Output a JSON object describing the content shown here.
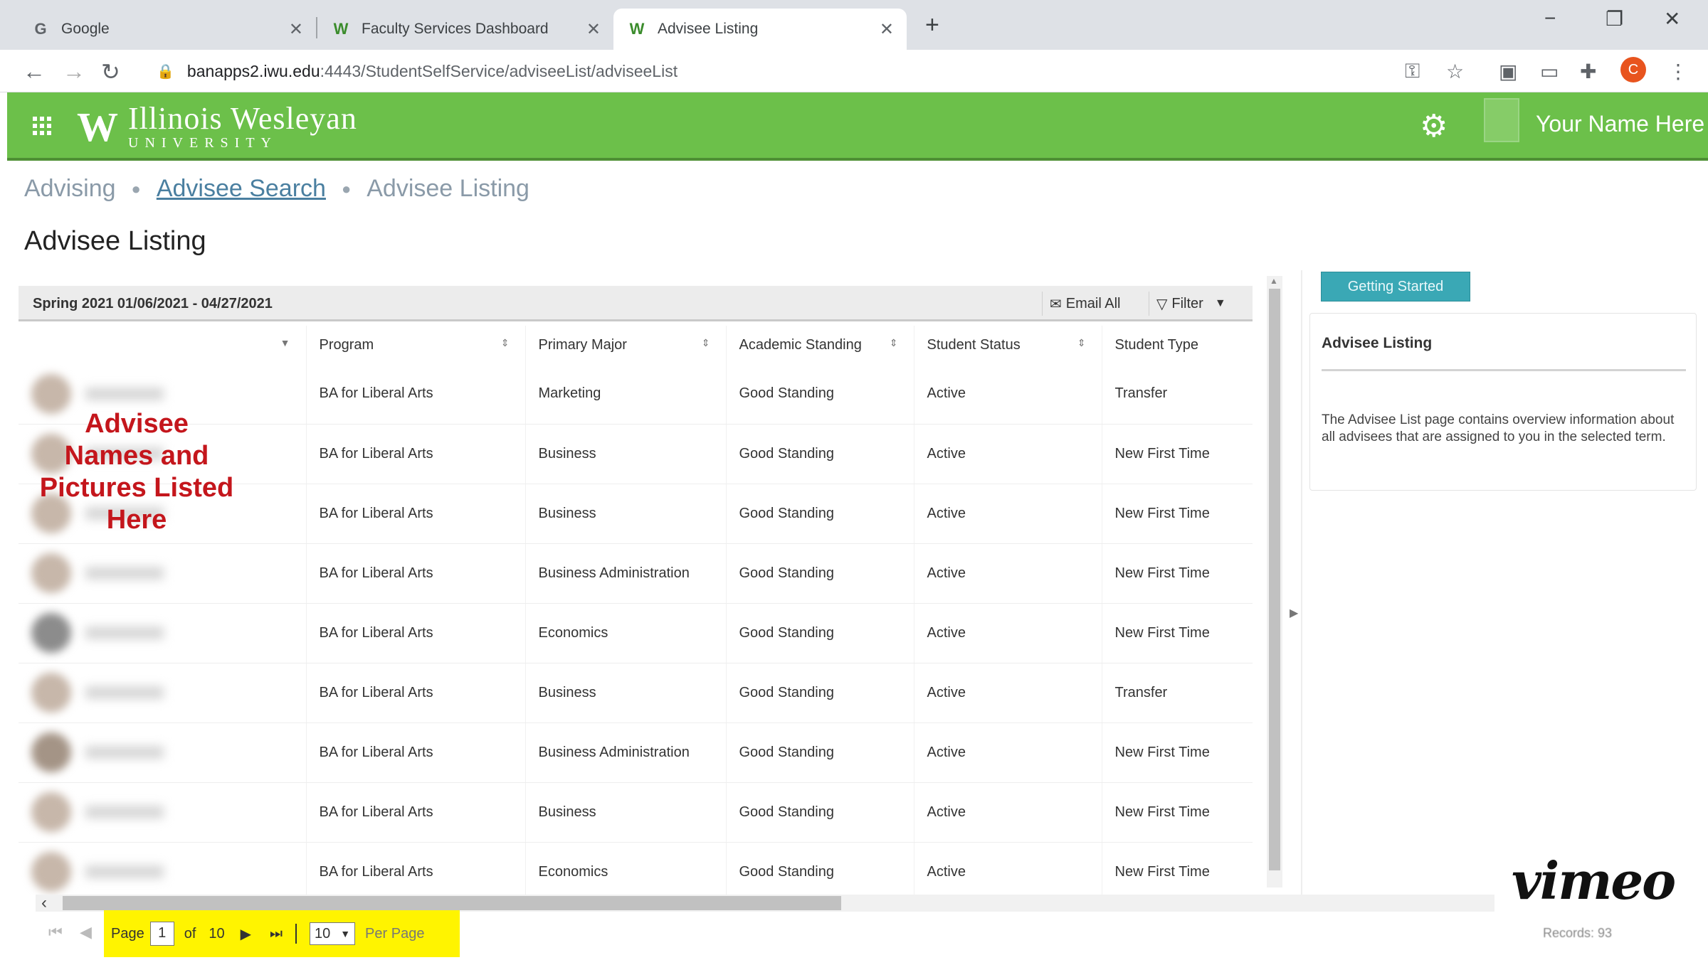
{
  "browser": {
    "tabs": [
      {
        "favicon": "G",
        "title": "Google"
      },
      {
        "favicon": "W",
        "title": "Faculty Services Dashboard"
      },
      {
        "favicon": "W",
        "title": "Advisee Listing"
      }
    ],
    "url_host": "banapps2.iwu.edu",
    "url_path": ":4443/StudentSelfService/adviseeList/adviseeList",
    "profile_initial": "C"
  },
  "header": {
    "logo_line1": "Illinois Wesleyan",
    "logo_line2": "UNIVERSITY",
    "user_name": "Your Name Here"
  },
  "breadcrumb": {
    "items": [
      "Advising",
      "Advisee Search",
      "Advisee Listing"
    ]
  },
  "page_title": "Advisee Listing",
  "term": {
    "label": "Spring 2021 01/06/2021 - 04/27/2021",
    "email_all": "Email All",
    "filter": "Filter"
  },
  "table": {
    "columns": [
      "Program",
      "Primary Major",
      "Academic Standing",
      "Student Status",
      "Student Type"
    ],
    "rows": [
      [
        "BA for Liberal Arts",
        "Marketing",
        "Good Standing",
        "Active",
        "Transfer"
      ],
      [
        "BA for Liberal Arts",
        "Business",
        "Good Standing",
        "Active",
        "New First Time"
      ],
      [
        "BA for Liberal Arts",
        "Business",
        "Good Standing",
        "Active",
        "New First Time"
      ],
      [
        "BA for Liberal Arts",
        "Business Administration",
        "Good Standing",
        "Active",
        "New First Time"
      ],
      [
        "BA for Liberal Arts",
        "Economics",
        "Good Standing",
        "Active",
        "New First Time"
      ],
      [
        "BA for Liberal Arts",
        "Business",
        "Good Standing",
        "Active",
        "Transfer"
      ],
      [
        "BA for Liberal Arts",
        "Business Administration",
        "Good Standing",
        "Active",
        "New First Time"
      ],
      [
        "BA for Liberal Arts",
        "Business",
        "Good Standing",
        "Active",
        "New First Time"
      ],
      [
        "BA for Liberal Arts",
        "Economics",
        "Good Standing",
        "Active",
        "New First Time"
      ]
    ]
  },
  "overlay_note": "Advisee Names and Pictures Listed Here",
  "pager": {
    "page_label": "Page",
    "current_page": "1",
    "of_label": "of",
    "total_pages": "10",
    "per_page_value": "10",
    "per_page_label": "Per Page",
    "records": "Records: 93"
  },
  "side_panel": {
    "button": "Getting Started",
    "title": "Advisee Listing",
    "body": "The Advisee List page contains overview information about all advisees that are assigned to you in the selected term."
  },
  "watermark": "vimeo",
  "colors": {
    "header_green": "#6cc04a",
    "button_teal": "#3aa8b5",
    "highlight_yellow": "#fff400",
    "overlay_red": "#c4161c"
  }
}
